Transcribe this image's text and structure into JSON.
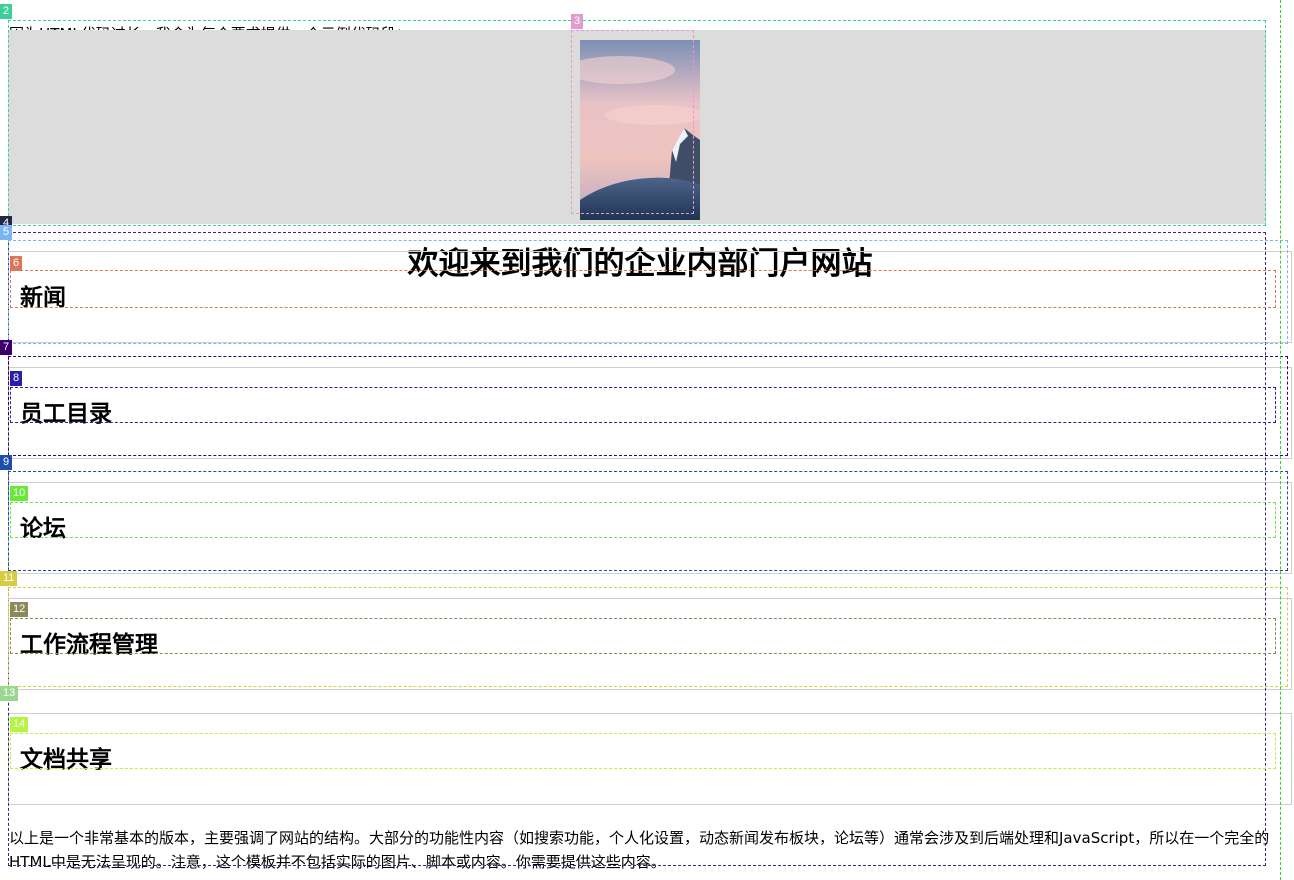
{
  "intro": {
    "text": "因为HTML代码过长，我会为每个要求提供一个示例代码段："
  },
  "hero": {
    "image_icon": "mountain-sunset-photo"
  },
  "page_title": "欢迎来到我们的企业内部门户网站",
  "sections": [
    {
      "title": "新闻"
    },
    {
      "title": "员工目录"
    },
    {
      "title": "论坛"
    },
    {
      "title": "工作流程管理"
    },
    {
      "title": "文档共享"
    }
  ],
  "footer_note": "以上是一个非常基本的版本，主要强调了网站的结构。大部分的功能性内容（如搜索功能，个人化设置，动态新闻发布板块，论坛等）通常会涉及到后端处理和JavaScript，所以在一个完全的HTML中是无法呈现的。注意，这个模板并不包括实际的图片、脚本或内容。你需要提供这些内容。",
  "overlay_tags": [
    "2",
    "3",
    "4",
    "5",
    "6",
    "7",
    "8",
    "9",
    "10",
    "11",
    "12",
    "13",
    "14"
  ],
  "colors": {
    "hero_background": "#dcdcdc",
    "section_border": "#cfcfcf"
  }
}
